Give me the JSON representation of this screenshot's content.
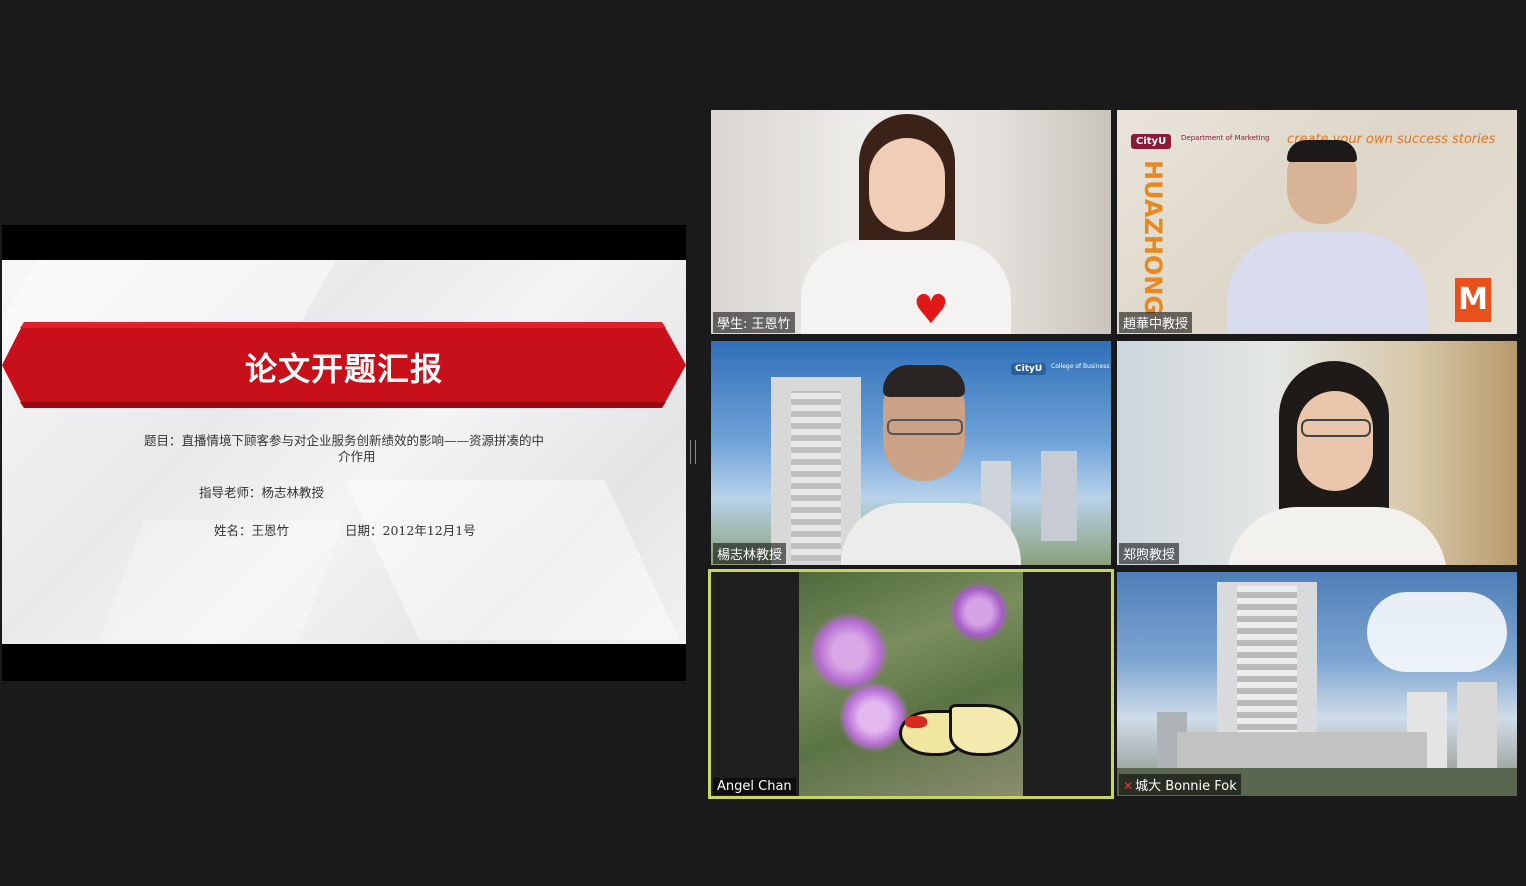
{
  "shared_screen": {
    "slide_title": "论文开题汇报",
    "topic_line1": "题目：直播情境下顾客参与对企业服务创新绩效的影响——资源拼凑的中",
    "topic_line2": "介作用",
    "advisor": "指导老师：杨志林教授",
    "name": "姓名：王恩竹",
    "date": "日期：2012年12月1号"
  },
  "participants": [
    {
      "name": "學生: 王恩竹"
    },
    {
      "name": "趙華中教授",
      "backdrop_text": "create your own success stories",
      "dept_text": "Department of Marketing",
      "logo_text": "CityU",
      "vertical_text": "HUAZHONG"
    },
    {
      "name": "楊志林教授",
      "logo_text": "CityU",
      "college_text": "College of Business"
    },
    {
      "name": "郑煦教授"
    },
    {
      "name": "Angel Chan",
      "active_speaker": true
    },
    {
      "name": "城大 Bonnie Fok",
      "muted": true
    }
  ],
  "colors": {
    "background": "#1a1a1a",
    "banner_red": "#c8101a",
    "active_border": "#c7d75c"
  }
}
